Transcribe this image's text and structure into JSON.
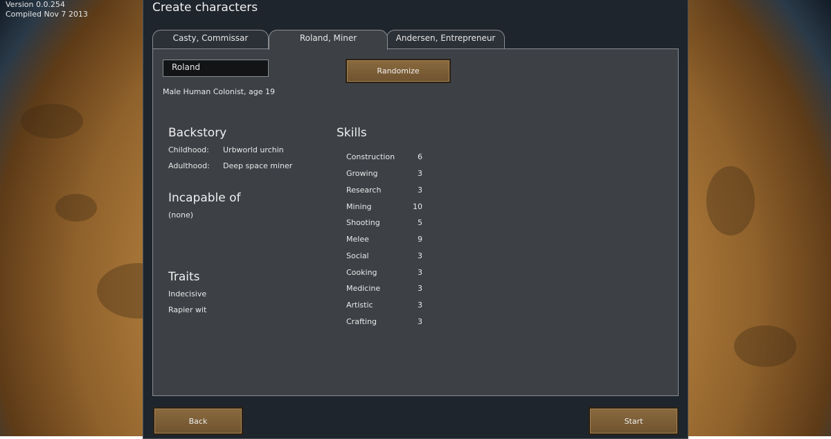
{
  "version": {
    "line1": "Version 0.0.254",
    "line2": "Compiled Nov 7 2013"
  },
  "window_title": "Create characters",
  "tabs": [
    {
      "label": "Casty, Commissar",
      "active": false
    },
    {
      "label": "Roland, Miner",
      "active": true
    },
    {
      "label": "Andersen, Entrepreneur",
      "active": false
    }
  ],
  "character": {
    "name_value": "Roland",
    "description": "Male Human Colonist, age 19"
  },
  "randomize_label": "Randomize",
  "backstory": {
    "heading": "Backstory",
    "childhood_label": "Childhood:",
    "childhood_value": "Urbworld urchin",
    "adulthood_label": "Adulthood:",
    "adulthood_value": "Deep space miner"
  },
  "incapable": {
    "heading": "Incapable of",
    "value": "(none)"
  },
  "traits": {
    "heading": "Traits",
    "items": [
      "Indecisive",
      "Rapier wit"
    ]
  },
  "skills": {
    "heading": "Skills",
    "items": [
      {
        "name": "Construction",
        "value": "6"
      },
      {
        "name": "Growing",
        "value": "3"
      },
      {
        "name": "Research",
        "value": "3"
      },
      {
        "name": "Mining",
        "value": "10"
      },
      {
        "name": "Shooting",
        "value": "5"
      },
      {
        "name": "Melee",
        "value": "9"
      },
      {
        "name": "Social",
        "value": "3"
      },
      {
        "name": "Cooking",
        "value": "3"
      },
      {
        "name": "Medicine",
        "value": "3"
      },
      {
        "name": "Artistic",
        "value": "3"
      },
      {
        "name": "Crafting",
        "value": "3"
      }
    ]
  },
  "buttons": {
    "back": "Back",
    "start": "Start"
  },
  "colors": {
    "button": "#7d5f37",
    "panel": "#3d4146",
    "window": "#1e252d"
  }
}
